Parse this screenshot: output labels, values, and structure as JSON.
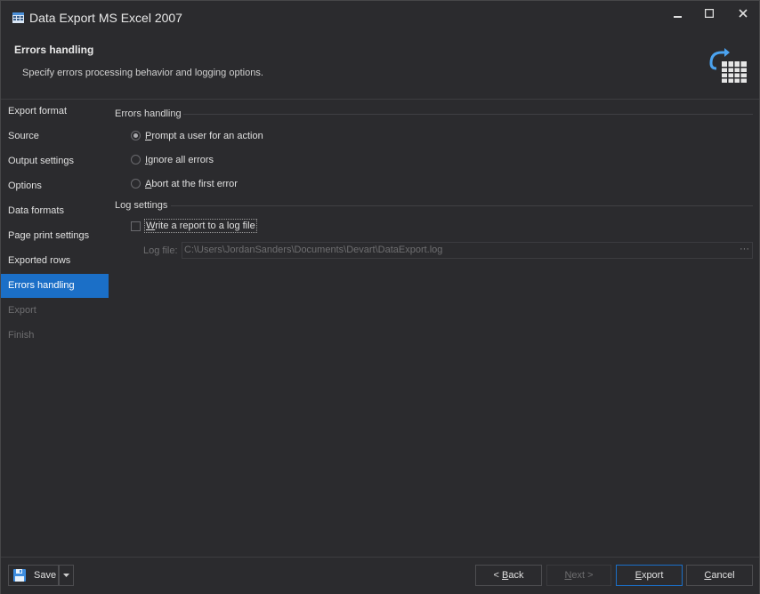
{
  "window": {
    "title": "Data Export MS Excel 2007",
    "controls": {
      "minimize": "—",
      "maximize": "☐",
      "close": "✕"
    }
  },
  "header": {
    "title": "Errors handling",
    "subtitle": "Specify errors processing behavior and logging options."
  },
  "sidebar": {
    "items": [
      {
        "label": "Export format",
        "state": "normal"
      },
      {
        "label": "Source",
        "state": "normal"
      },
      {
        "label": "Output settings",
        "state": "normal"
      },
      {
        "label": "Options",
        "state": "normal"
      },
      {
        "label": "Data formats",
        "state": "normal"
      },
      {
        "label": "Page print settings",
        "state": "normal"
      },
      {
        "label": "Exported rows",
        "state": "normal"
      },
      {
        "label": "Errors handling",
        "state": "active"
      },
      {
        "label": "Export",
        "state": "disabled"
      },
      {
        "label": "Finish",
        "state": "disabled"
      }
    ]
  },
  "errors_handling": {
    "group_title": "Errors handling",
    "options": [
      {
        "label": "Prompt a user for an action",
        "checked": true
      },
      {
        "label": "Ignore all errors",
        "checked": false
      },
      {
        "label": "Abort at the first error",
        "checked": false
      }
    ]
  },
  "log_settings": {
    "group_title": "Log settings",
    "write_report_label": "Write a report to a log file",
    "write_report_checked": false,
    "log_file_label": "Log file:",
    "log_file_value": "C:\\Users\\JordanSanders\\Documents\\Devart\\DataExport.log",
    "browse_label": "···"
  },
  "footer": {
    "save_label": "Save",
    "back_label": "< Back",
    "next_label": "Next >",
    "export_label": "Export",
    "cancel_label": "Cancel"
  },
  "colors": {
    "accent": "#1b6fc7",
    "background": "#2b2b2e"
  }
}
